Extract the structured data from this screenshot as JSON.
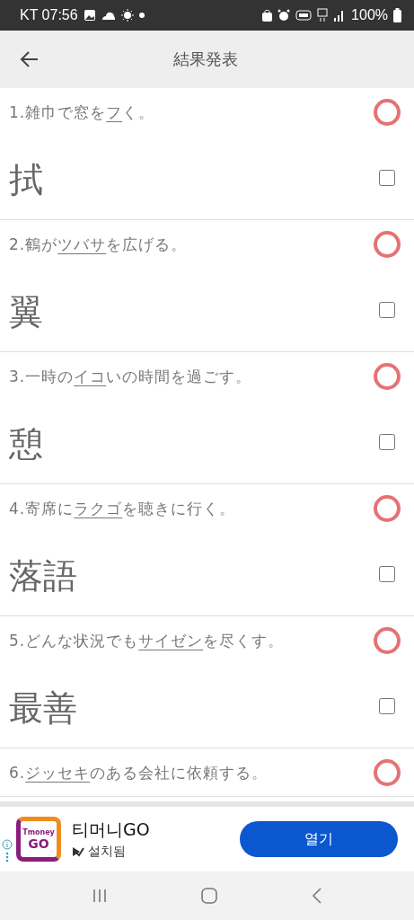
{
  "status_bar": {
    "carrier_time": "KT 07:56",
    "battery": "100%"
  },
  "header": {
    "title": "結果発表"
  },
  "questions": [
    {
      "parts": [
        {
          "text": "1.雑巾で窓を",
          "underlined": false
        },
        {
          "text": "フ",
          "underlined": true
        },
        {
          "text": "く。",
          "underlined": false
        }
      ],
      "answer": "拭",
      "correct": true,
      "checked": false
    },
    {
      "parts": [
        {
          "text": "2.鶴が",
          "underlined": false
        },
        {
          "text": "ツバサ",
          "underlined": true
        },
        {
          "text": "を広げる。",
          "underlined": false
        }
      ],
      "answer": "翼",
      "correct": true,
      "checked": false
    },
    {
      "parts": [
        {
          "text": "3.一時の",
          "underlined": false
        },
        {
          "text": "イコ",
          "underlined": true
        },
        {
          "text": "いの時間を過ごす。",
          "underlined": false
        }
      ],
      "answer": "憩",
      "correct": true,
      "checked": false
    },
    {
      "parts": [
        {
          "text": "4.寄席に",
          "underlined": false
        },
        {
          "text": "ラクゴ",
          "underlined": true
        },
        {
          "text": "を聴きに行く。",
          "underlined": false
        }
      ],
      "answer": "落語",
      "correct": true,
      "checked": false
    },
    {
      "parts": [
        {
          "text": "5.どんな状況でも",
          "underlined": false
        },
        {
          "text": "サイゼン",
          "underlined": true
        },
        {
          "text": "を尽くす。",
          "underlined": false
        }
      ],
      "answer": "最善",
      "correct": true,
      "checked": false
    },
    {
      "parts": [
        {
          "text": "6.",
          "underlined": false
        },
        {
          "text": "ジッセキ",
          "underlined": true
        },
        {
          "text": "のある会社に依頼する。",
          "underlined": false
        }
      ],
      "correct": true
    }
  ],
  "ad": {
    "logo_small": "Tmoney",
    "logo_big": "GO",
    "app_name": "티머니GO",
    "status": "설치됨",
    "button": "열기"
  }
}
